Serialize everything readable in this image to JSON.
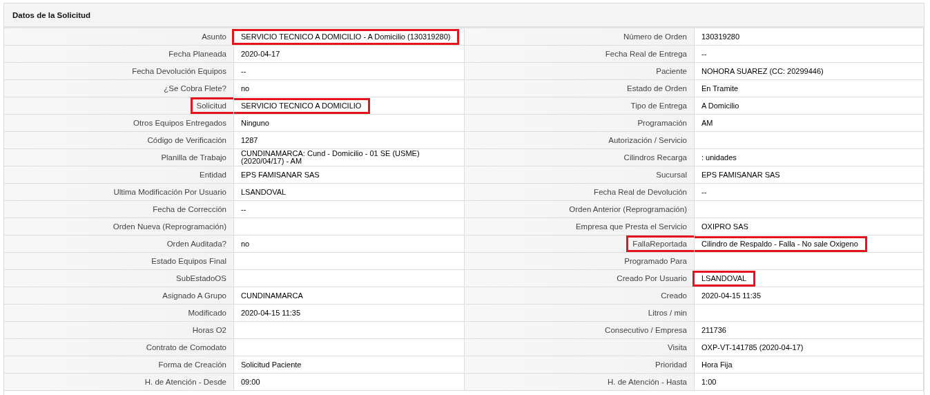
{
  "panel": {
    "title": "Datos de la Solicitud"
  },
  "rows": [
    {
      "left": {
        "label": "Asunto",
        "value": "SERVICIO TECNICO A DOMICILIO - A Domicilio (130319280)",
        "highlighted": true,
        "label_highlighted": false
      },
      "right": {
        "label": "Número de Orden",
        "value": "130319280",
        "highlighted": false,
        "label_highlighted": false
      }
    },
    {
      "left": {
        "label": "Fecha Planeada",
        "value": "2020-04-17",
        "highlighted": false,
        "label_highlighted": false
      },
      "right": {
        "label": "Fecha Real de Entrega",
        "value": "--",
        "highlighted": false,
        "label_highlighted": false
      }
    },
    {
      "left": {
        "label": "Fecha Devolución Equipos",
        "value": "--",
        "highlighted": false,
        "label_highlighted": false
      },
      "right": {
        "label": "Paciente",
        "value": "NOHORA SUAREZ (CC: 20299446)",
        "highlighted": false,
        "label_highlighted": false
      }
    },
    {
      "left": {
        "label": "¿Se Cobra Flete?",
        "value": "no",
        "highlighted": false,
        "label_highlighted": false
      },
      "right": {
        "label": "Estado de Orden",
        "value": "En Tramite",
        "highlighted": false,
        "label_highlighted": false
      }
    },
    {
      "left": {
        "label": "Solicitud",
        "value": "SERVICIO TECNICO A DOMICILIO",
        "highlighted": true,
        "label_highlighted": true
      },
      "right": {
        "label": "Tipo de Entrega",
        "value": "A Domicilio",
        "highlighted": false,
        "label_highlighted": false
      }
    },
    {
      "left": {
        "label": "Otros Equipos Entregados",
        "value": "Ninguno",
        "highlighted": false,
        "label_highlighted": false
      },
      "right": {
        "label": "Programación",
        "value": "AM",
        "highlighted": false,
        "label_highlighted": false
      }
    },
    {
      "left": {
        "label": "Código de Verificación",
        "value": "1287",
        "highlighted": false,
        "label_highlighted": false
      },
      "right": {
        "label": "Autorización / Servicio",
        "label_highlighted": false
      }
    },
    {
      "left": {
        "label": "Planilla de Trabajo",
        "value": "CUNDINAMARCA: Cund - Domicilio - 01 SE (USME) (2020/04/17) - AM",
        "highlighted": false,
        "label_highlighted": false
      },
      "right": {
        "label": "Cilindros Recarga",
        "value": ": unidades",
        "highlighted": false,
        "label_highlighted": false
      }
    },
    {
      "left": {
        "label": "Entidad",
        "value": "EPS FAMISANAR SAS",
        "highlighted": false,
        "label_highlighted": false
      },
      "right": {
        "label": "Sucursal",
        "value": "EPS FAMISANAR SAS",
        "highlighted": false,
        "label_highlighted": false
      }
    },
    {
      "left": {
        "label": "Ultima Modificación Por Usuario",
        "value": "LSANDOVAL",
        "highlighted": false,
        "label_highlighted": false
      },
      "right": {
        "label": "Fecha Real de Devolución",
        "value": "--",
        "highlighted": false,
        "label_highlighted": false
      }
    },
    {
      "left": {
        "label": "Fecha de Corrección",
        "value": "--",
        "highlighted": false,
        "label_highlighted": false
      },
      "right": {
        "label": "Orden Anterior (Reprogramación)",
        "label_highlighted": false
      }
    },
    {
      "left": {
        "label": "Orden Nueva (Reprogramación)",
        "label_highlighted": false
      },
      "right": {
        "label": "Empresa que Presta el Servicio",
        "value": "OXIPRO SAS",
        "highlighted": false,
        "label_highlighted": false
      }
    },
    {
      "left": {
        "label": "Orden Auditada?",
        "value": "no",
        "highlighted": false,
        "label_highlighted": false
      },
      "right": {
        "label": "FallaReportada",
        "value": "Cilindro de Respaldo - Falla - No sale Oxigeno",
        "highlighted": true,
        "label_highlighted": true
      }
    },
    {
      "left": {
        "label": "Estado Equipos Final",
        "label_highlighted": false
      },
      "right": {
        "label": "Programado Para",
        "label_highlighted": false
      }
    },
    {
      "left": {
        "label": "SubEstadoOS",
        "label_highlighted": false
      },
      "right": {
        "label": "Creado Por Usuario",
        "value": "LSANDOVAL",
        "highlighted": true,
        "label_highlighted": false
      }
    },
    {
      "left": {
        "label": "Asignado A Grupo",
        "value": "CUNDINAMARCA",
        "highlighted": false,
        "label_highlighted": false
      },
      "right": {
        "label": "Creado",
        "value": "2020-04-15 11:35",
        "highlighted": false,
        "label_highlighted": false
      }
    },
    {
      "left": {
        "label": "Modificado",
        "value": "2020-04-15 11:35",
        "highlighted": false,
        "label_highlighted": false
      },
      "right": {
        "label": "Litros / min",
        "label_highlighted": false
      }
    },
    {
      "left": {
        "label": "Horas O2",
        "label_highlighted": false
      },
      "right": {
        "label": "Consecutivo / Empresa",
        "value": "211736",
        "highlighted": false,
        "label_highlighted": false
      }
    },
    {
      "left": {
        "label": "Contrato de Comodato",
        "label_highlighted": false
      },
      "right": {
        "label": "Visita",
        "value": "OXP-VT-141785 (2020-04-17)",
        "highlighted": false,
        "label_highlighted": false
      }
    },
    {
      "left": {
        "label": "Forma de Creación",
        "value": "Solicitud Paciente",
        "highlighted": false,
        "label_highlighted": false
      },
      "right": {
        "label": "Prioridad",
        "value": "Hora Fija",
        "highlighted": false,
        "label_highlighted": false
      }
    },
    {
      "left": {
        "label": "H. de Atención - Desde",
        "value": "09:00",
        "highlighted": false,
        "label_highlighted": false
      },
      "right": {
        "label": "H. de Atención - Hasta",
        "value": "1:00",
        "highlighted": false,
        "label_highlighted": false
      }
    }
  ]
}
